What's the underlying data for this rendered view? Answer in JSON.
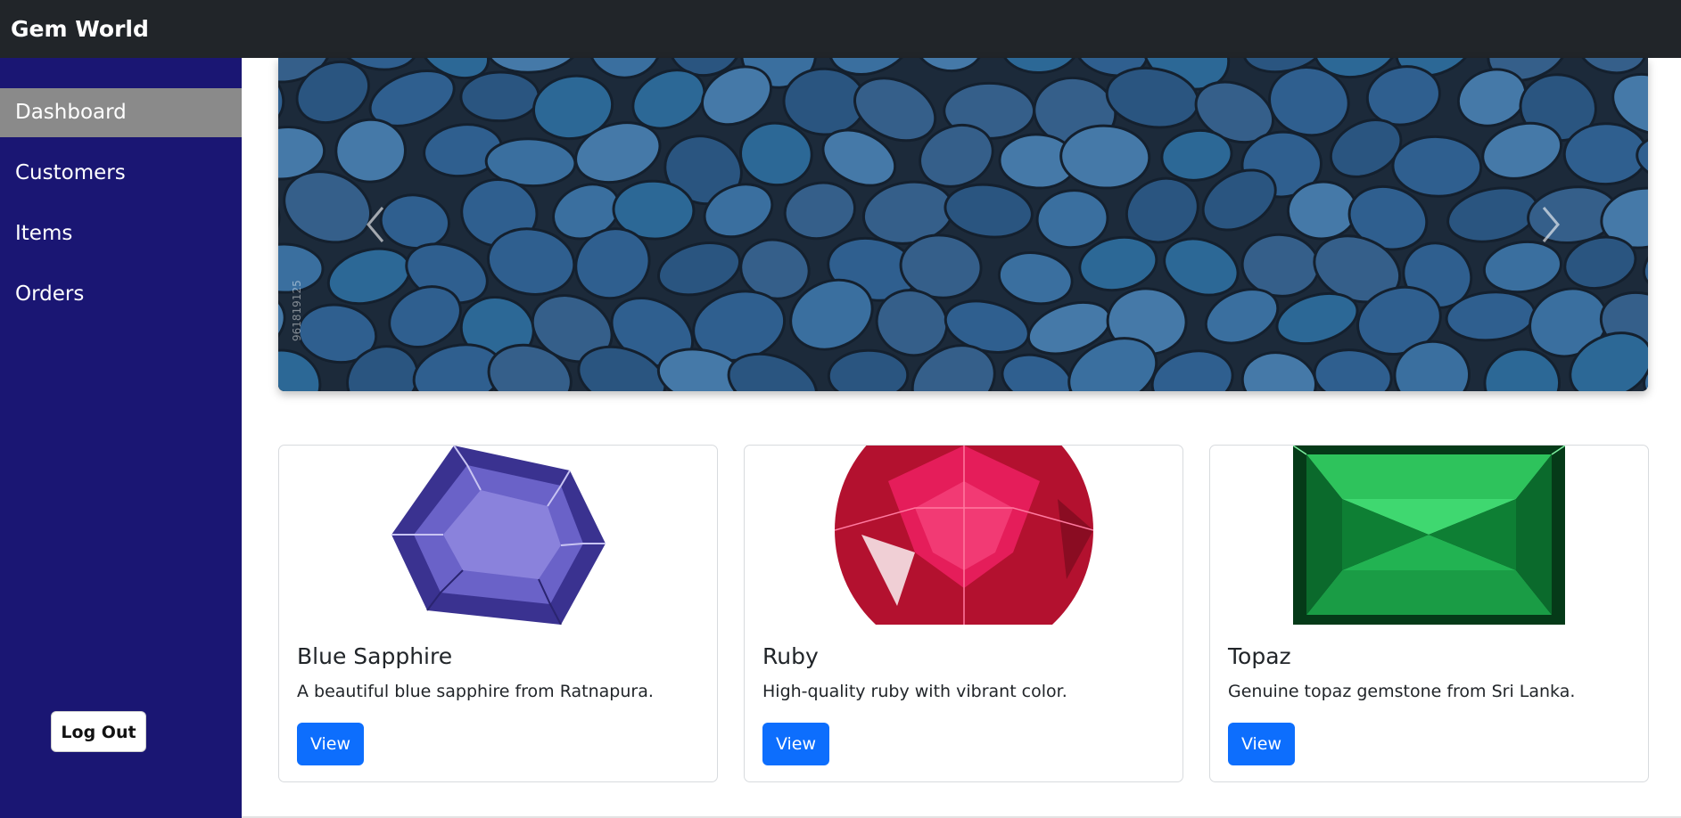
{
  "app": {
    "brand": "Gem World"
  },
  "sidebar": {
    "items": [
      {
        "label": "Dashboard",
        "active": true
      },
      {
        "label": "Customers",
        "active": false
      },
      {
        "label": "Items",
        "active": false
      },
      {
        "label": "Orders",
        "active": false
      }
    ],
    "logout_label": "Log Out"
  },
  "carousel": {
    "watermark": "961819125",
    "prev_icon": "chevron-left-icon",
    "next_icon": "chevron-right-icon"
  },
  "cards": [
    {
      "title": "Blue Sapphire",
      "text": "A beautiful blue sapphire from Ratnapura.",
      "button": "View",
      "gem_color": "#5a52b8"
    },
    {
      "title": "Ruby",
      "text": "High-quality ruby with vibrant color.",
      "button": "View",
      "gem_color": "#d4154a"
    },
    {
      "title": "Topaz",
      "text": "Genuine topaz gemstone from Sri Lanka.",
      "button": "View",
      "gem_color": "#1fa84a"
    }
  ],
  "colors": {
    "navbar": "#212529",
    "sidebar": "#1a1673",
    "sidebar_active": "#8a8a8a",
    "primary_button": "#0d6efd"
  }
}
